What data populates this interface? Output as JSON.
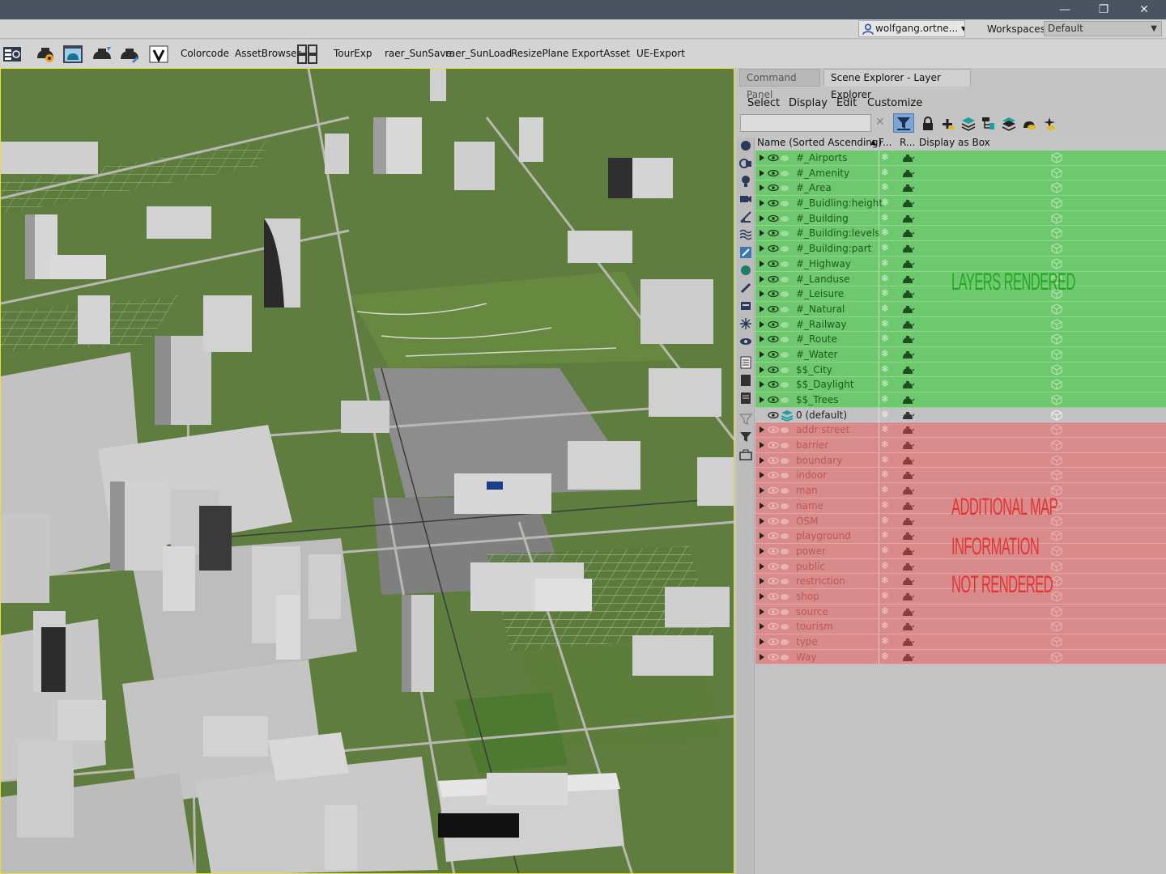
{
  "window": {
    "minimize": "—",
    "restore": "❐",
    "close": "✕"
  },
  "account": {
    "user": "wolfgang.ortne...",
    "user_caret": "▾",
    "workspaces_label": "Workspaces:",
    "workspace_value": "Default",
    "workspace_caret": "▼"
  },
  "toolbar": {
    "items": [
      "Colorcode",
      "AssetBrowser",
      "TourExp",
      "raer_SunSave",
      "raer_SunLoad",
      "ResizePlane",
      "ExportAsset",
      "UE-Export"
    ]
  },
  "panel": {
    "tabs": [
      "Command Panel",
      "Scene Explorer - Layer Explorer"
    ],
    "menu": [
      "Select",
      "Display",
      "Edit",
      "Customize"
    ],
    "search_value": "",
    "clear": "✕",
    "columns": {
      "name": "Name (Sorted Ascending)",
      "sort_arrow": "▲",
      "frozen": "F...",
      "render": "R...",
      "box": "Display as Box"
    }
  },
  "layers_rendered": [
    "#_Airports",
    "#_Amenity",
    "#_Area",
    "#_Buidling:height",
    "#_Building",
    "#_Building:levels",
    "#_Building:part",
    "#_Highway",
    "#_Landuse",
    "#_Leisure",
    "#_Natural",
    "#_Railway",
    "#_Route",
    "#_Water",
    "$$_City",
    "$$_Daylight",
    "$$_Trees"
  ],
  "default_layer": "0 (default)",
  "layers_not_rendered": [
    "addr:street",
    "barrier",
    "boundary",
    "indoor",
    "man",
    "name",
    "OSM",
    "playground",
    "power",
    "public",
    "restriction",
    "shop",
    "source",
    "tourism",
    "type",
    "Way"
  ],
  "annotations": {
    "rendered": "LAYERS RENDERED",
    "not_rendered_1": "ADDITIONAL MAP",
    "not_rendered_2": "INFORMATION",
    "not_rendered_3": "NOT RENDERED"
  },
  "colors": {
    "rendered_row": "#6ec86e",
    "not_rendered_row": "#d98b8b",
    "viewport_border": "#e8e02a",
    "annot_green": "#22a822",
    "annot_red": "#e03535"
  }
}
